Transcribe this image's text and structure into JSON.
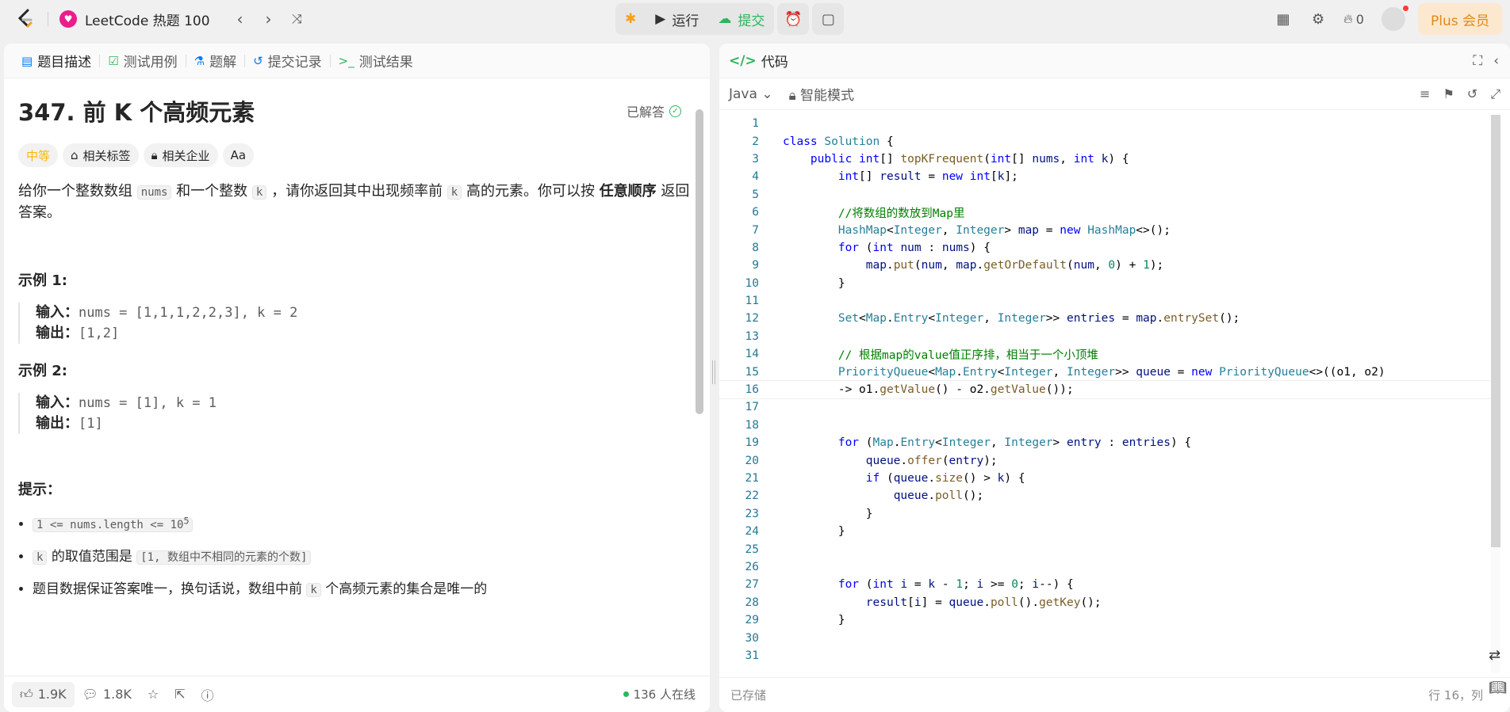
{
  "topbar": {
    "title": "LeetCode 热题 100",
    "run_label": "运行",
    "submit_label": "提交",
    "fire_count": "0",
    "plus_label": "Plus 会员"
  },
  "left": {
    "tabs": [
      "题目描述",
      "测试用例",
      "题解",
      "提交记录",
      "测试结果"
    ],
    "title": "347. 前 K 个高频元素",
    "solved_label": "已解答",
    "tags": [
      "中等",
      "相关标签",
      "相关企业",
      "Aa"
    ],
    "desc_parts": [
      "给你一个整数数组 ",
      "nums",
      " 和一个整数 ",
      "k",
      " ，请你返回其中出现频率前 ",
      "k",
      " 高的元素。你可以按 ",
      "任意顺序",
      " 返回答案。"
    ],
    "example1_title": "示例 1:",
    "example1_input_label": "输入：",
    "example1_input": "nums = [1,1,1,2,2,3], k = 2",
    "example1_output_label": "输出：",
    "example1_output": "[1,2]",
    "example2_title": "示例 2:",
    "example2_input_label": "输入：",
    "example2_input": "nums = [1], k = 1",
    "example2_output_label": "输出：",
    "example2_output": "[1]",
    "hint_title": "提示：",
    "hint1": "1 <= nums.length <= 10",
    "hint1_sup": "5",
    "hint2_code": "k",
    "hint2_text": " 的取值范围是 ",
    "hint2_range": "[1, 数组中不相同的元素的个数]",
    "hint3_pre": "题目数据保证答案唯一，换句话说，数组中前 ",
    "hint3_code": "k",
    "hint3_post": " 个高频元素的集合是唯一的",
    "likes": "1.9K",
    "comments": "1.8K",
    "online": "136 人在线"
  },
  "right": {
    "tab_label": "代码",
    "language": "Java",
    "mode": "智能模式",
    "saved": "已存储",
    "cursor_pos": "行 16，列"
  },
  "code_lines": [
    "",
    "class Solution {",
    "    public int[] topKFrequent(int[] nums, int k) {",
    "        int[] result = new int[k];",
    "",
    "        //将数组的数放到Map里",
    "        HashMap<Integer, Integer> map = new HashMap<>();",
    "        for (int num : nums) {",
    "            map.put(num, map.getOrDefault(num, 0) + 1);",
    "        }",
    "",
    "        Set<Map.Entry<Integer, Integer>> entries = map.entrySet();",
    "",
    "        // 根据map的value值正序排，相当于一个小顶堆",
    "        PriorityQueue<Map.Entry<Integer, Integer>> queue = new PriorityQueue<>((o1, o2)",
    "        -> o1.getValue() - o2.getValue());",
    "",
    "",
    "        for (Map.Entry<Integer, Integer> entry : entries) {",
    "            queue.offer(entry);",
    "            if (queue.size() > k) {",
    "                queue.poll();",
    "            }",
    "        }",
    "",
    "",
    "        for (int i = k - 1; i >= 0; i--) {",
    "            result[i] = queue.poll().getKey();",
    "        }",
    "",
    ""
  ]
}
